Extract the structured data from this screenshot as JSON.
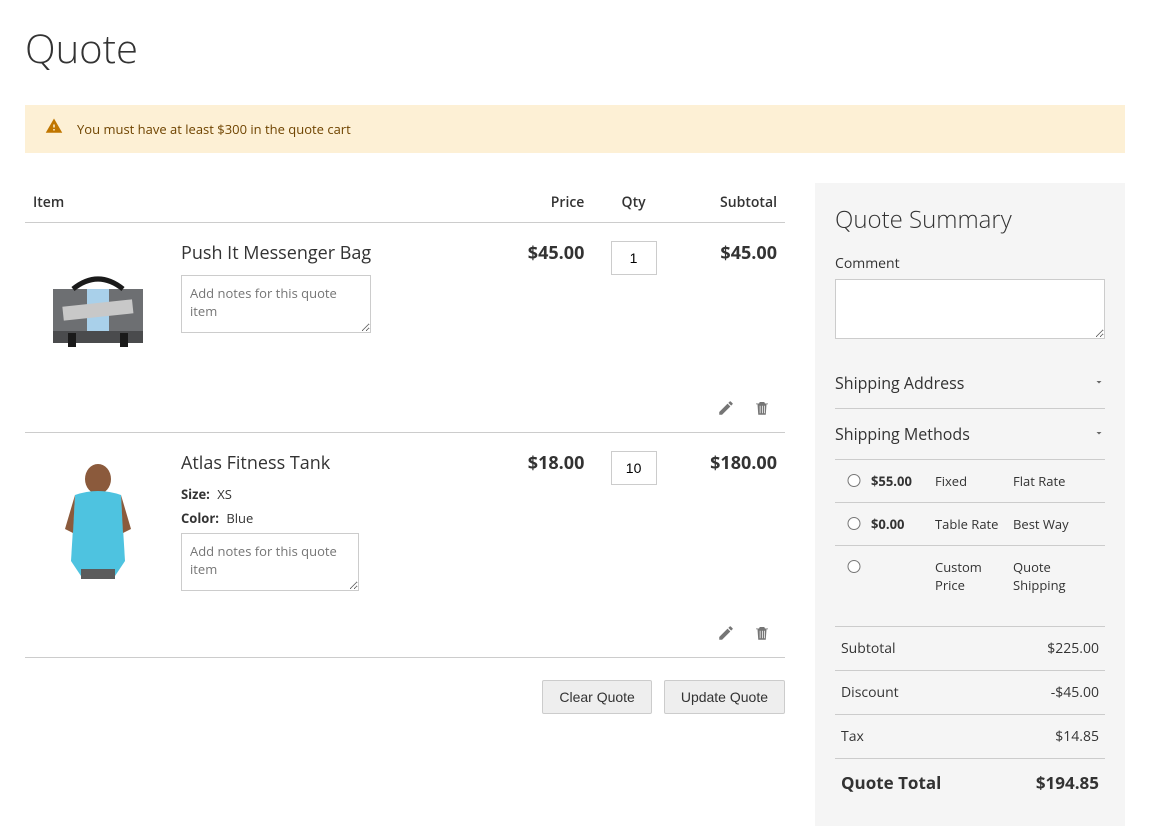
{
  "page_title": "Quote",
  "warning_message": "You must have at least $300 in the quote cart",
  "table_headers": {
    "item": "Item",
    "price": "Price",
    "qty": "Qty",
    "subtotal": "Subtotal"
  },
  "notes_placeholder": "Add notes for this quote item",
  "items": [
    {
      "name": "Push It Messenger Bag",
      "price": "$45.00",
      "qty": "1",
      "subtotal": "$45.00",
      "attrs": []
    },
    {
      "name": "Atlas Fitness Tank",
      "price": "$18.00",
      "qty": "10",
      "subtotal": "$180.00",
      "attrs": [
        {
          "label": "Size:",
          "value": "XS"
        },
        {
          "label": "Color:",
          "value": "Blue"
        }
      ]
    }
  ],
  "cart_actions": {
    "clear": "Clear Quote",
    "update": "Update Quote"
  },
  "summary": {
    "title": "Quote Summary",
    "comment_label": "Comment",
    "shipping_address_label": "Shipping Address",
    "shipping_methods_label": "Shipping Methods",
    "methods": [
      {
        "price": "$55.00",
        "name": "Fixed",
        "carrier": "Flat Rate"
      },
      {
        "price": "$0.00",
        "name": "Table Rate",
        "carrier": "Best Way"
      },
      {
        "price": "",
        "name": "Custom Price",
        "carrier": "Quote Shipping"
      }
    ],
    "totals": {
      "subtotal_label": "Subtotal",
      "subtotal_value": "$225.00",
      "discount_label": "Discount",
      "discount_value": "-$45.00",
      "tax_label": "Tax",
      "tax_value": "$14.85",
      "grand_label": "Quote Total",
      "grand_value": "$194.85"
    }
  }
}
